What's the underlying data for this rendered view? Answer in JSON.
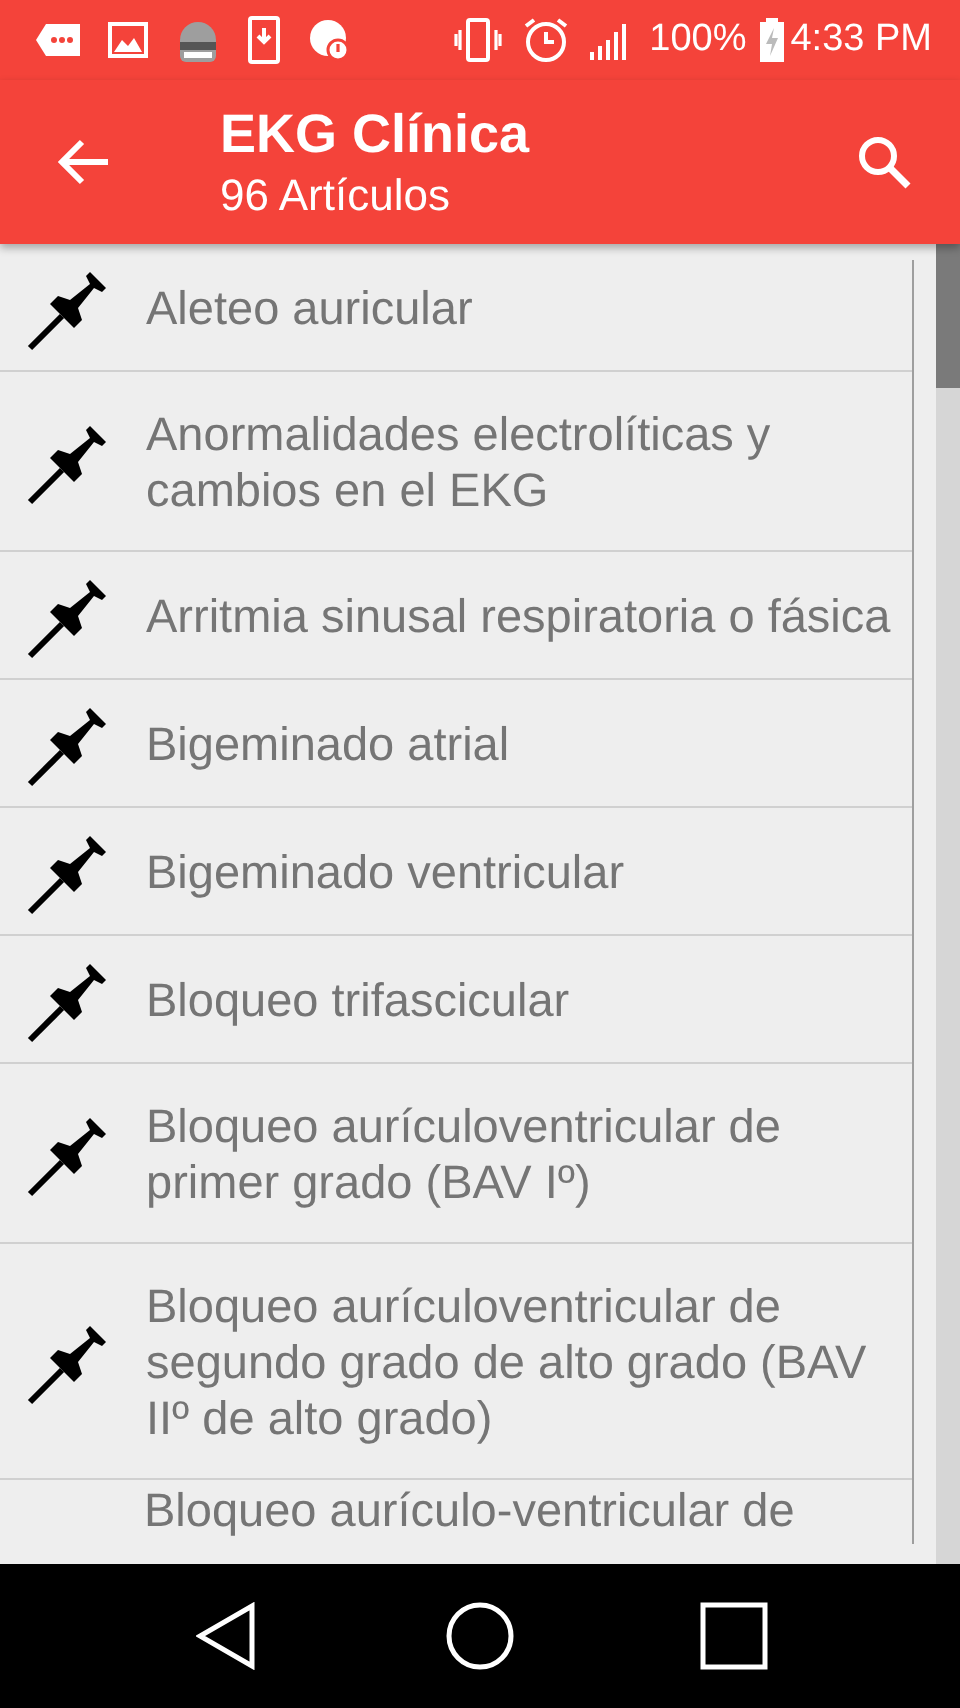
{
  "status_bar": {
    "battery_text": "100%",
    "time": "4:33 PM"
  },
  "app_bar": {
    "title": "EKG Clínica",
    "subtitle": "96 Artículos"
  },
  "articles": [
    {
      "title": "Aleteo auricular"
    },
    {
      "title": "Anormalidades electrolíticas y cambios en el EKG"
    },
    {
      "title": "Arritmia sinusal respiratoria o fásica"
    },
    {
      "title": "Bigeminado atrial"
    },
    {
      "title": "Bigeminado ventricular"
    },
    {
      "title": "Bloqueo trifascicular"
    },
    {
      "title": "Bloqueo aurículoventricular de primer grado (BAV Iº)"
    },
    {
      "title": "Bloqueo aurículoventricular de segundo grado de alto grado (BAV IIº de alto grado)"
    },
    {
      "title": "Bloqueo aurículo-ventricular de"
    }
  ]
}
